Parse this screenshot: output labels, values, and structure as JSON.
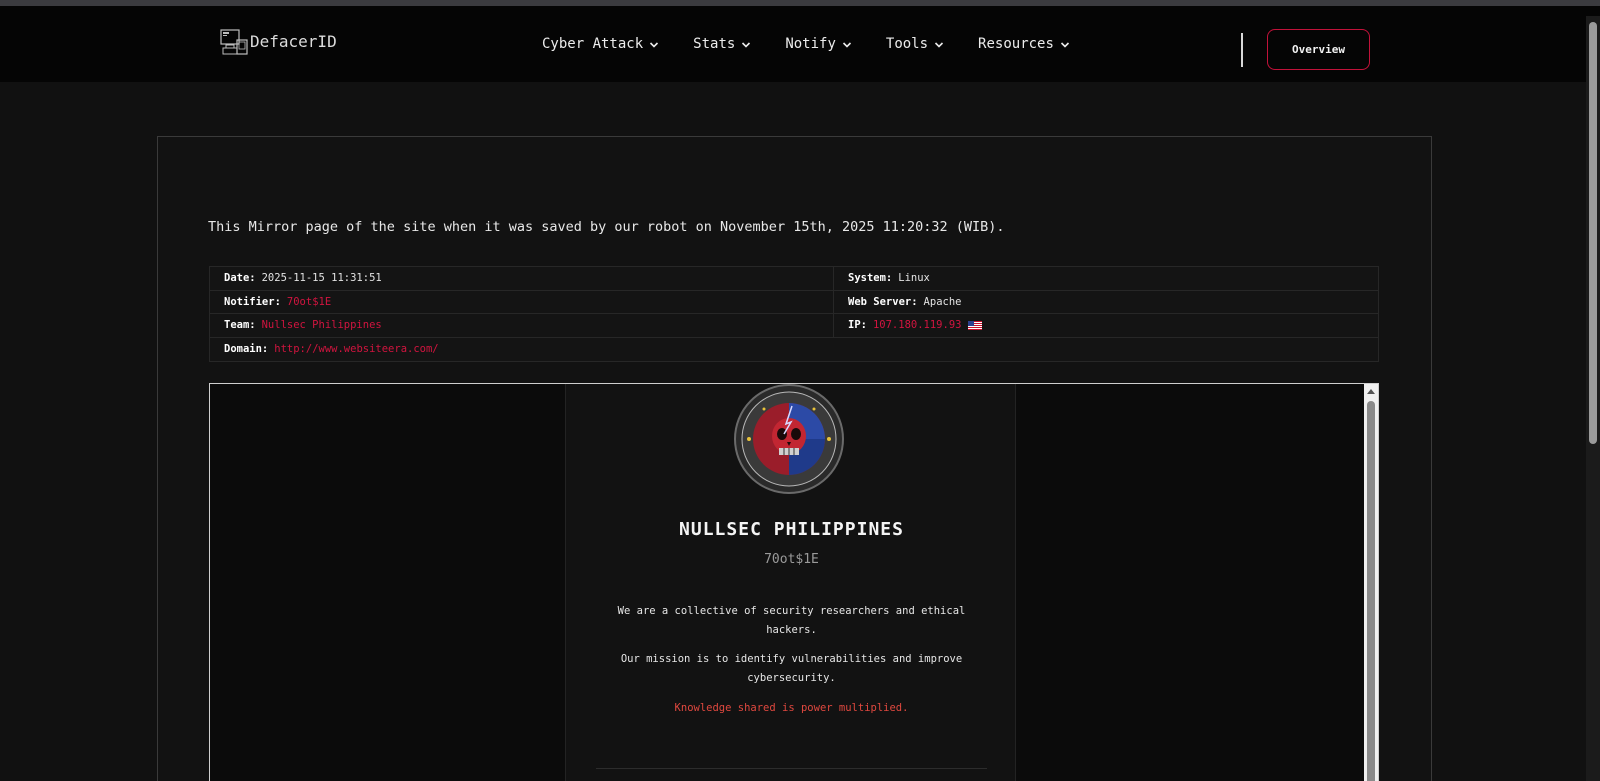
{
  "brand": {
    "name": "DefacerID",
    "icon": "computer-devices-icon"
  },
  "nav": {
    "items": [
      {
        "label": "Cyber Attack"
      },
      {
        "label": "Stats"
      },
      {
        "label": "Notify"
      },
      {
        "label": "Tools"
      },
      {
        "label": "Resources"
      }
    ],
    "overview_label": "Overview"
  },
  "mirror": {
    "notice": "This Mirror page of the site when it was saved by our robot on November 15th, 2025 11:20:32 (WIB)."
  },
  "info": {
    "date_label": "Date:",
    "date_value": "2025-11-15 11:31:51",
    "system_label": "System:",
    "system_value": "Linux",
    "notifier_label": "Notifier:",
    "notifier_value": "70ot$1E",
    "webserver_label": "Web Server:",
    "webserver_value": "Apache",
    "team_label": "Team:",
    "team_value": "Nullsec Philippines",
    "ip_label": "IP:",
    "ip_value": "107.180.119.93",
    "ip_flag": "us-flag-icon",
    "domain_label": "Domain:",
    "domain_value": "http://www.websiteera.com/"
  },
  "mirror_page": {
    "emblem": "nullsec-skull-emblem",
    "group_name": "NULLSEC PHILIPPINES",
    "handle": "70ot$1E",
    "paragraph1": "We are a collective of security researchers and ethical hackers.",
    "paragraph2": "Our mission is to identify vulnerabilities and improve cybersecurity.",
    "paragraph3": "Knowledge shared is power multiplied."
  },
  "colors": {
    "accent": "#d1143f",
    "background": "#111111",
    "navbar": "#050505",
    "highlight_text": "#e0483f"
  }
}
